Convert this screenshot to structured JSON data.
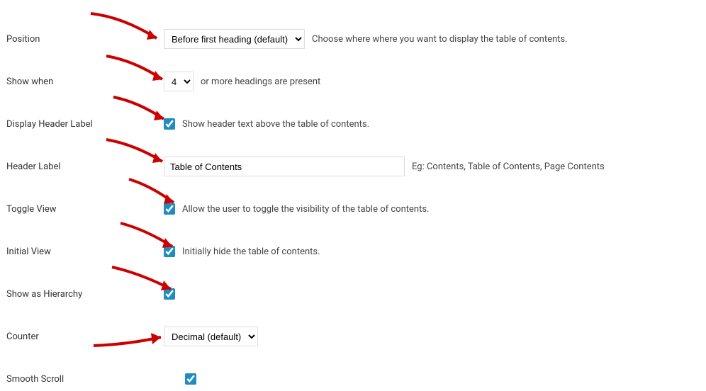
{
  "labels": {
    "position": "Position",
    "show_when": "Show when",
    "display_header_label": "Display Header Label",
    "header_label": "Header Label",
    "toggle_view": "Toggle View",
    "initial_view": "Initial View",
    "show_hierarchy": "Show as Hierarchy",
    "counter": "Counter",
    "smooth_scroll": "Smooth Scroll"
  },
  "values": {
    "position": "Before first heading (default)",
    "show_when": "4",
    "header_label": "Table of Contents",
    "counter": "Decimal (default)"
  },
  "descriptions": {
    "position": "Choose where where you want to display the table of contents.",
    "show_when": "or more headings are present",
    "display_header_label": "Show header text above the table of contents.",
    "header_label": "Eg: Contents, Table of Contents, Page Contents",
    "toggle_view": "Allow the user to toggle the visibility of the table of contents.",
    "initial_view": "Initially hide the table of contents."
  }
}
